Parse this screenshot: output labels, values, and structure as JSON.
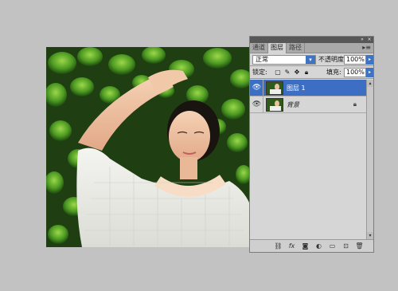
{
  "panel": {
    "titlebar": {
      "collapse_icon": "double-chevron-icon",
      "close_icon": "close-icon"
    },
    "tabs": [
      {
        "label": "通道",
        "active": false
      },
      {
        "label": "图层",
        "active": true
      },
      {
        "label": "路径",
        "active": false
      }
    ],
    "menu_icon": "panel-menu-icon",
    "blend_mode": {
      "value": "正常"
    },
    "opacity": {
      "label": "不透明度:",
      "value": "100%"
    },
    "lock": {
      "label": "锁定:",
      "icons": [
        "lock-transparent-icon",
        "lock-brush-icon",
        "lock-move-icon",
        "lock-all-icon"
      ]
    },
    "fill": {
      "label": "填充:",
      "value": "100%"
    },
    "layers": [
      {
        "name": "图层 1",
        "visible": true,
        "selected": true,
        "locked": false
      },
      {
        "name": "背景",
        "visible": true,
        "selected": false,
        "locked": true
      }
    ],
    "bottom_icons": [
      "link-icon",
      "fx-icon",
      "mask-icon",
      "adjustment-icon",
      "group-icon",
      "new-layer-icon",
      "trash-icon"
    ]
  },
  "colors": {
    "selection": "#3c6fc4",
    "canvas_background": "#c2c2c2"
  }
}
